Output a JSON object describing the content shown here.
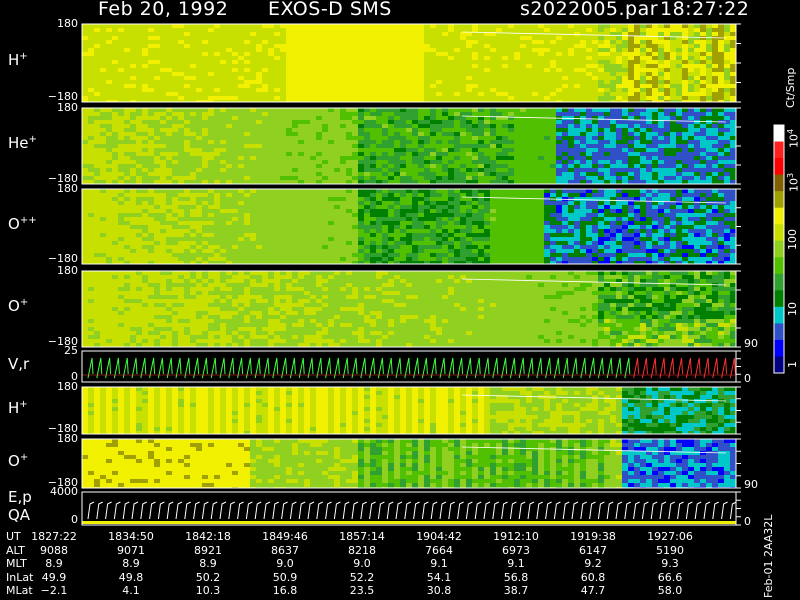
{
  "header": {
    "date": "Feb 20, 1992",
    "instrument": "EXOS-D SMS",
    "file": "s2022005.par",
    "time": "18:27:22"
  },
  "colors": {
    "spectrogram_scale": [
      "#000080",
      "#0000ff",
      "#3050c8",
      "#00c8c8",
      "#008000",
      "#30a030",
      "#50c000",
      "#90d020",
      "#c8e000",
      "#f0f000",
      "#a0a000",
      "#806000",
      "#ff0000",
      "#ff2020",
      "#ffffff"
    ],
    "axis": "#ffffff",
    "pitch_trace_green": "#40ff40",
    "pitch_trace_red": "#ff3030"
  },
  "colorbar": {
    "unit_label": "Ct/Smp",
    "tick_labels": [
      "1",
      "10",
      "100",
      "10",
      "10"
    ],
    "tick_exponents": [
      "",
      "",
      "",
      "3",
      "4"
    ]
  },
  "chart_data": {
    "type": "heatmap",
    "x_axis_label": "UT",
    "panels": [
      {
        "label": "H",
        "charge": "+",
        "ymax": "180",
        "ymin": "−180",
        "pattern": "h",
        "right_label": ""
      },
      {
        "label": "He",
        "charge": "+",
        "ymax": "180",
        "ymin": "−180",
        "pattern": "he",
        "right_label": ""
      },
      {
        "label": "O",
        "charge": "++",
        "ymax": "180",
        "ymin": "−180",
        "pattern": "opp",
        "right_label": ""
      },
      {
        "label": "O",
        "charge": "+",
        "ymax": "180",
        "ymin": "−180",
        "pattern": "op",
        "right_label": "90"
      },
      {
        "label": "V,r",
        "charge": "",
        "ymax": "25",
        "ymin": "0",
        "pattern": "line",
        "right_label": "0"
      },
      {
        "label": "H",
        "charge": "+",
        "ymax": "180",
        "ymin": "−180",
        "pattern": "h2",
        "right_label": ""
      },
      {
        "label": "O",
        "charge": "+",
        "ymax": "180",
        "ymin": "−180",
        "pattern": "o2",
        "right_label": "90"
      },
      {
        "label": "E,p",
        "label2": "QA",
        "charge": "",
        "ymax": "4000",
        "ymin": "0",
        "pattern": "ep",
        "right_label": "0"
      }
    ],
    "ut": [
      "1827:22",
      "1834:50",
      "1842:18",
      "1849:46",
      "1857:14",
      "1904:42",
      "1912:10",
      "1919:38",
      "1927:06"
    ],
    "alt": [
      "9088",
      "9071",
      "8921",
      "8637",
      "8218",
      "7664",
      "6973",
      "6147",
      "5190"
    ],
    "mlt": [
      "8.9",
      "8.9",
      "8.9",
      "9.0",
      "9.0",
      "9.1",
      "9.1",
      "9.2",
      "9.3"
    ],
    "inlat": [
      "49.9",
      "49.8",
      "50.2",
      "50.9",
      "52.2",
      "54.1",
      "56.8",
      "60.8",
      "66.6"
    ],
    "mlat": [
      "−2.1",
      "4.1",
      "10.3",
      "16.8",
      "23.5",
      "30.8",
      "38.7",
      "47.7",
      "58.0"
    ],
    "row_labels": [
      "UT",
      "ALT",
      "MLT",
      "InLat",
      "MLat"
    ]
  },
  "side_note": "Feb-01 2AA32L"
}
